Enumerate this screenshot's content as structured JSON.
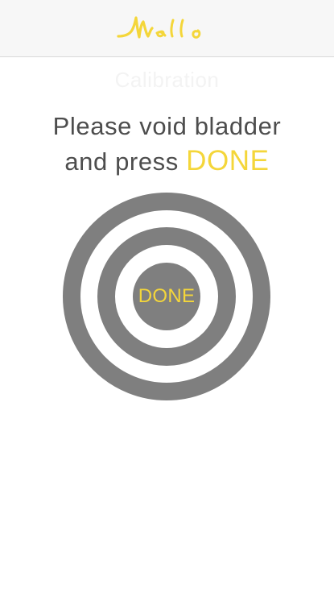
{
  "header": {
    "logo_text": "Mello"
  },
  "screen": {
    "subtitle": "Calibration",
    "instruction_line1": "Please void bladder",
    "instruction_line2_prefix": "and press ",
    "instruction_line2_accent": "DONE"
  },
  "target": {
    "button_label": "DONE"
  },
  "colors": {
    "accent": "#f4d63a",
    "ring": "#7f7f7f",
    "text": "#4d4d4d",
    "header_bg": "#f7f7f7"
  }
}
